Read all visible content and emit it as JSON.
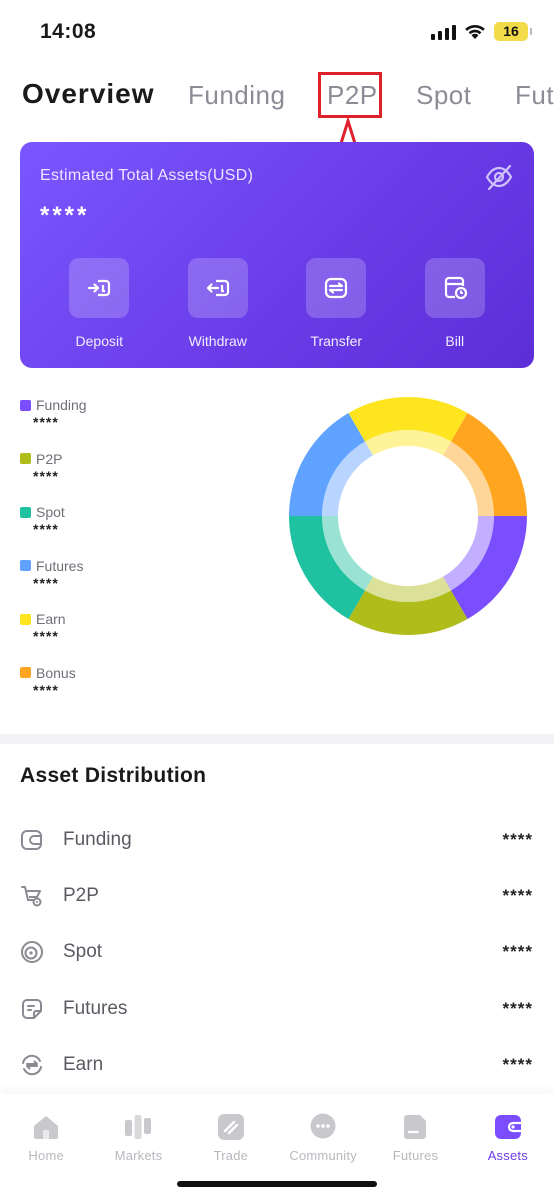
{
  "status_bar": {
    "time": "14:08",
    "battery": "16"
  },
  "tabs": [
    {
      "label": "Overview",
      "active": true
    },
    {
      "label": "Funding",
      "active": false
    },
    {
      "label": "P2P",
      "active": false
    },
    {
      "label": "Spot",
      "active": false
    },
    {
      "label": "Fut",
      "active": false
    }
  ],
  "annotation": {
    "highlighted_tab": "P2P",
    "color": "#e0202a"
  },
  "assets_card": {
    "title": "Estimated Total Assets(USD)",
    "value": "****",
    "actions": [
      {
        "label": "Deposit",
        "icon": "deposit-icon"
      },
      {
        "label": "Withdraw",
        "icon": "withdraw-icon"
      },
      {
        "label": "Transfer",
        "icon": "transfer-icon"
      },
      {
        "label": "Bill",
        "icon": "bill-icon"
      }
    ]
  },
  "legend": [
    {
      "name": "Funding",
      "value": "****",
      "color": "#7a4dff"
    },
    {
      "name": "P2P",
      "value": "****",
      "color": "#b0bc1a"
    },
    {
      "name": "Spot",
      "value": "****",
      "color": "#1ec2a0"
    },
    {
      "name": "Futures",
      "value": "****",
      "color": "#5fa2ff"
    },
    {
      "name": "Earn",
      "value": "****",
      "color": "#ffe51f"
    },
    {
      "name": "Bonus",
      "value": "****",
      "color": "#ffa51f"
    }
  ],
  "chart_data": {
    "type": "pie",
    "categories": [
      "Funding",
      "P2P",
      "Spot",
      "Futures",
      "Earn",
      "Bonus"
    ],
    "values": [
      1,
      1,
      1,
      1,
      1,
      1
    ],
    "colors": [
      "#7a4dff",
      "#b0bc1a",
      "#1ec2a0",
      "#5fa2ff",
      "#ffe51f",
      "#ffa51f"
    ],
    "donut": true
  },
  "distribution": {
    "title": "Asset Distribution",
    "rows": [
      {
        "name": "Funding",
        "value": "****",
        "icon": "wallet-icon"
      },
      {
        "name": "P2P",
        "value": "****",
        "icon": "cart-icon"
      },
      {
        "name": "Spot",
        "value": "****",
        "icon": "coin-icon"
      },
      {
        "name": "Futures",
        "value": "****",
        "icon": "document-icon"
      },
      {
        "name": "Earn",
        "value": "****",
        "icon": "exchange-icon"
      }
    ]
  },
  "bottom_nav": [
    {
      "label": "Home",
      "icon": "home-icon",
      "active": false
    },
    {
      "label": "Markets",
      "icon": "markets-icon",
      "active": false
    },
    {
      "label": "Trade",
      "icon": "trade-icon",
      "active": false
    },
    {
      "label": "Community",
      "icon": "community-icon",
      "active": false
    },
    {
      "label": "Futures",
      "icon": "futures-icon",
      "active": false
    },
    {
      "label": "Assets",
      "icon": "assets-icon",
      "active": true
    }
  ],
  "colors": {
    "accent": "#6a3de8",
    "annotation": "#e0202a"
  }
}
